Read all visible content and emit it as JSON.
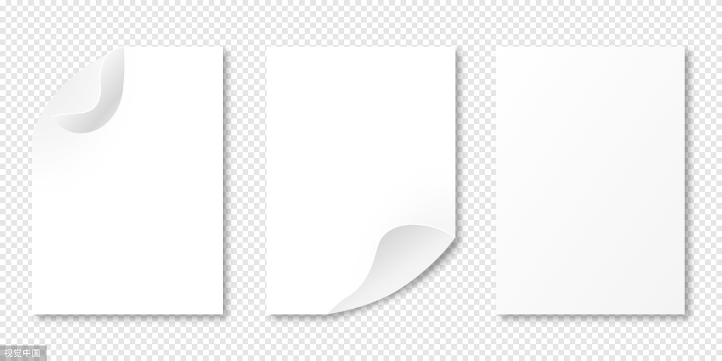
{
  "canvas": {
    "background": "transparency-checkerboard",
    "checker_light": "#ffffff",
    "checker_dark": "#e6e6e6"
  },
  "sheets": [
    {
      "name": "paper-sheet-curled-top-left",
      "corner_curl": "top-left",
      "color": "#ffffff"
    },
    {
      "name": "paper-sheet-curled-bottom-right",
      "corner_curl": "bottom-right",
      "color": "#ffffff"
    },
    {
      "name": "paper-sheet-flat",
      "corner_curl": "none",
      "color": "#ffffff"
    }
  ],
  "watermark": {
    "text": "视觉中国"
  }
}
